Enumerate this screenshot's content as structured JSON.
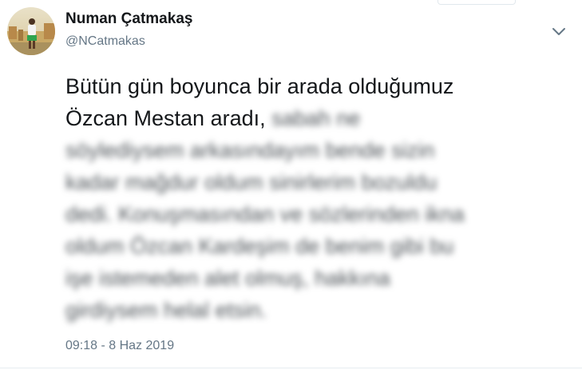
{
  "user": {
    "display_name": "Numan Çatmakaş",
    "screen_name": "@NCatmakas"
  },
  "tweet": {
    "visible_text": "Bütün gün boyunca bir arada olduğumuz Özcan Mestan aradı,",
    "line_1": "Bütün gün boyunca bir arada olduğumuz",
    "line_2_clear": "Özcan Mestan aradı,",
    "line_2_blurred": "sabah ne",
    "blurred_lines": [
      "söylediysem arkasındayım bende sizin",
      "kadar mağdur oldum sinirlerim bozuldu",
      "dedi. Konuşmasından ve sözlerinden ikna",
      "oldum Özcan Kardeşim de benim gibi bu",
      "işe istemeden alet olmuş, hakkına",
      "girdiysem helal etsin."
    ],
    "timestamp": "09:18 - 8 Haz 2019"
  },
  "icons": {
    "caret": "chevron-down-icon",
    "avatar": "user-avatar"
  },
  "colors": {
    "text_primary": "#14171a",
    "text_secondary": "#657786",
    "divider": "#e6ecf0"
  }
}
